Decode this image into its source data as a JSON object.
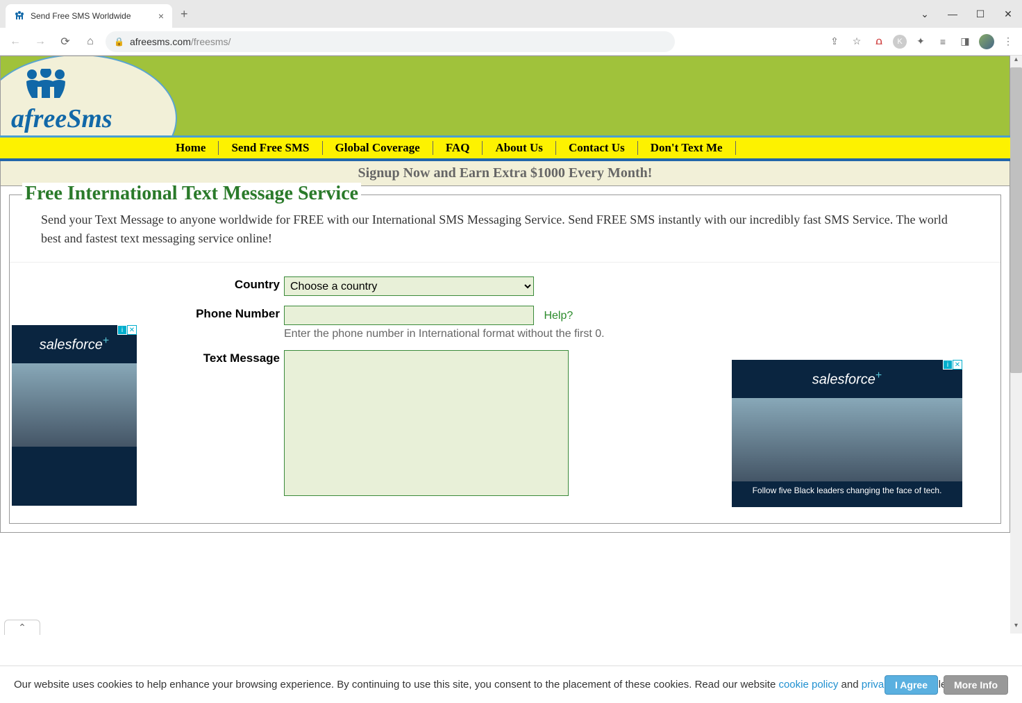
{
  "browser": {
    "tab_title": "Send Free SMS Worldwide",
    "url_domain": "afreesms.com",
    "url_path": "/freesms/"
  },
  "nav": {
    "items": [
      "Home",
      "Send Free SMS",
      "Global Coverage",
      "FAQ",
      "About Us",
      "Contact Us",
      "Don't Text Me"
    ]
  },
  "signup_banner": "Signup Now and Earn Extra $1000 Every Month!",
  "page_title": "Free International Text Message Service",
  "intro": "Send your Text Message to anyone worldwide for FREE with our International SMS Messaging Service. Send FREE SMS instantly with our incredibly fast SMS Service. The world best and fastest text messaging service online!",
  "form": {
    "country_label": "Country",
    "country_selected": "Choose a country",
    "phone_label": "Phone Number",
    "phone_help": "Help?",
    "phone_hint": "Enter the phone number in International format without the first 0.",
    "message_label": "Text Message"
  },
  "ads": {
    "brand": "salesforce",
    "tagline": "Follow five Black leaders changing the face of tech."
  },
  "cookie": {
    "text1": "Our website uses cookies to help enhance your browsing experience. By continuing to use this site, you consent to the placement of these cookies. Read our website ",
    "link1": "cookie policy",
    "text2": " and ",
    "link2": "privacy policy",
    "text3": " to learn more.",
    "agree": "I Agree",
    "more": "More Info"
  },
  "logo": {
    "prefix": "a",
    "mid": "free",
    "suffix": "Sms"
  }
}
